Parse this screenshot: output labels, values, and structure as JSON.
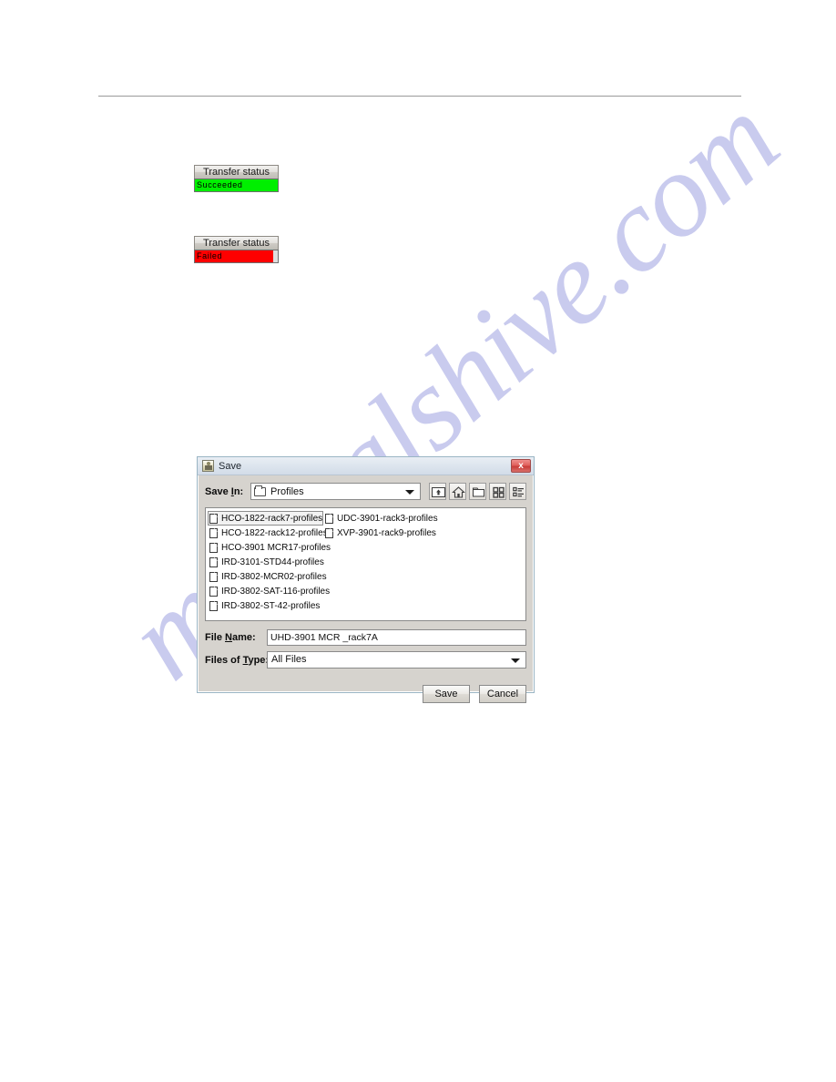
{
  "watermark": {
    "text": "manualshive.com",
    "color": "#c9cbee"
  },
  "status_widgets": [
    {
      "id": "succeeded",
      "title": "Transfer status",
      "value": "Succeeded",
      "bar_color": "#00ef00"
    },
    {
      "id": "failed",
      "title": "Transfer status",
      "value": "Failed",
      "bar_color": "#fe0000"
    }
  ],
  "save_dialog": {
    "title": "Save",
    "app_icon": "java-coffee-cup-icon",
    "close_label": "x",
    "save_in": {
      "label": "Save In:",
      "label_plain": "Save ",
      "label_mnemonic": "I",
      "label_tail": "n:",
      "value": "Profiles",
      "folder_icon": "folder-icon",
      "arrow_icon": "chevron-down-icon"
    },
    "toolbar": [
      {
        "name": "up-one-level-icon",
        "tooltip": "Up One Level"
      },
      {
        "name": "home-icon",
        "tooltip": "Home"
      },
      {
        "name": "create-new-folder-icon",
        "tooltip": "Create New Folder"
      },
      {
        "name": "list-view-icon",
        "tooltip": "List"
      },
      {
        "name": "details-view-icon",
        "tooltip": "Details"
      }
    ],
    "files": [
      {
        "name": "HCO-1822-rack7-profiles",
        "selected": true
      },
      {
        "name": "HCO-1822-rack12-profiles",
        "selected": false
      },
      {
        "name": "HCO-3901 MCR17-profiles",
        "selected": false
      },
      {
        "name": "IRD-3101-STD44-profiles",
        "selected": false
      },
      {
        "name": "IRD-3802-MCR02-profiles",
        "selected": false
      },
      {
        "name": "IRD-3802-SAT-116-profiles",
        "selected": false
      },
      {
        "name": "IRD-3802-ST-42-profiles",
        "selected": false
      },
      {
        "name": "UDC-3901-rack3-profiles",
        "selected": false
      },
      {
        "name": "XVP-3901-rack9-profiles",
        "selected": false
      }
    ],
    "file_name": {
      "label_plain": "File ",
      "label_mnemonic": "N",
      "label_tail": "ame:",
      "value": "UHD-3901 MCR _rack7A"
    },
    "files_of_type": {
      "label_plain": "Files of ",
      "label_mnemonic": "T",
      "label_tail": "ype:",
      "value": "All Files",
      "arrow_icon": "chevron-down-icon"
    },
    "buttons": {
      "save": "Save",
      "cancel": "Cancel"
    }
  }
}
